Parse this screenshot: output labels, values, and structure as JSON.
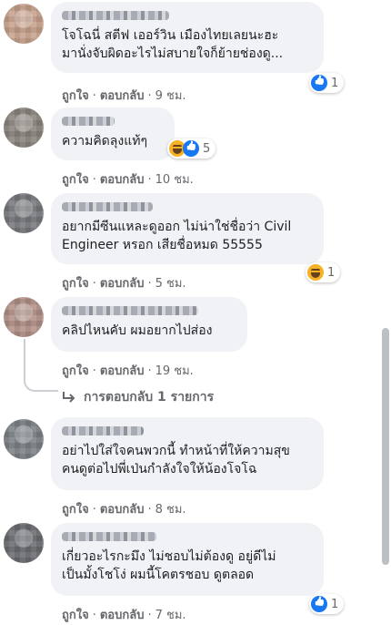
{
  "comments": [
    {
      "text": "โจโฉนี่ สตีฟ เออร์วิน เมืองไทยเลยนะฮะ\nมานั่งจับผิดอะไรไม่สบายใจก็ย้ายช่องดู...",
      "like": "ถูกใจ",
      "reply": "ตอบกลับ",
      "time": "9 ชม.",
      "reactions": "1",
      "avatar_color": "#c9a48f"
    },
    {
      "text": "ความคิดลุงแท้ๆ",
      "like": "ถูกใจ",
      "reply": "ตอบกลับ",
      "time": "10 ชม.",
      "reactions": "5",
      "avatar_color": "#8d8680"
    },
    {
      "text": "อยากมีซีนแหละดูออก ไม่น่าใช่ชื่อว่า Civil\nEngineer หรอก เสียชื่อหมด 55555",
      "like": "ถูกใจ",
      "reply": "ตอบกลับ",
      "time": "5 ชม.",
      "reactions": "1",
      "avatar_color": "#7a7c80"
    },
    {
      "text": "คลิปไหนคับ ผมอยากไปส่อง",
      "like": "ถูกใจ",
      "reply": "ตอบกลับ",
      "time": "19 ชม.",
      "replies_label": "การตอบกลับ 1 รายการ",
      "avatar_color": "#b4938a"
    },
    {
      "text": "อย่าไปใส่ใจคนพวกนี้ ทำหน้าที่ให้ความสุข\nคนดูต่อไปพี่เป่นกำลังใจให้น้องโจโฉ",
      "like": "ถูกใจ",
      "reply": "ตอบกลับ",
      "time": "8 ชม.",
      "avatar_color": "#7f8488"
    },
    {
      "text": "เกี่ยวอะไรกะมึง ไม่ชอบไม่ต้องดู อยู่ดีไม่\nเป็นมั้งโชโง่ ผมนี้โคตรชอบ ดูตลอด",
      "like": "ถูกใจ",
      "reply": "ตอบกลับ",
      "time": "7 ชม.",
      "reactions": "1",
      "avatar_color": "#6e6f73"
    }
  ],
  "colors": {
    "like_blue": "#1877f2",
    "haha_yellow": "#f7b125",
    "bubble": "#f0f2f5",
    "meta": "#65676b"
  },
  "icons": {
    "like": "like-icon",
    "haha": "haha-icon",
    "reply_arrow": "reply-arrow-icon"
  }
}
